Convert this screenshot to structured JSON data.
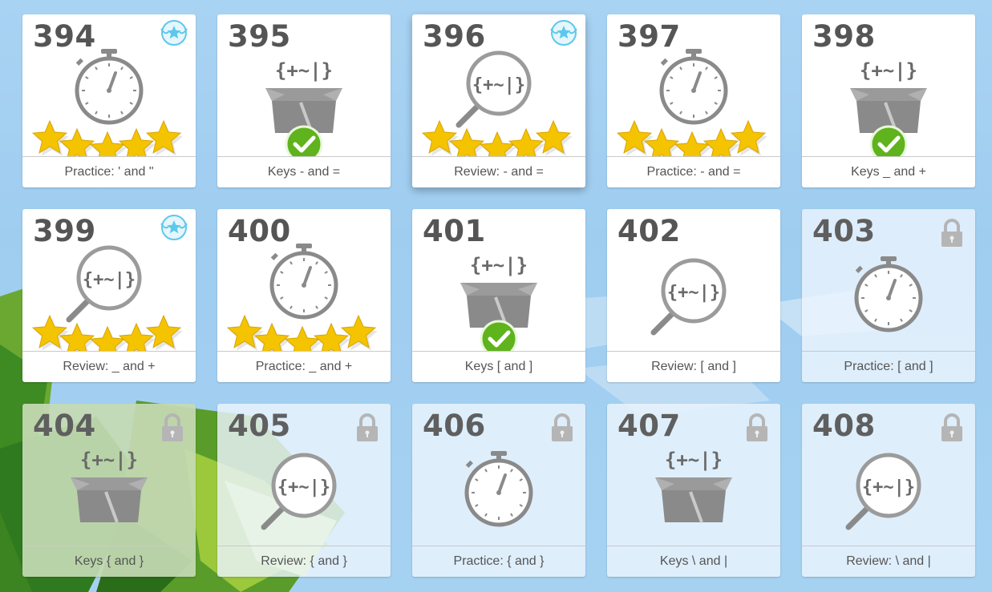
{
  "lessons": [
    {
      "number": "394",
      "label": "Practice: ' and \"",
      "kind": "timer",
      "stars": 5,
      "complete": false,
      "badge": true,
      "locked": false
    },
    {
      "number": "395",
      "label": "Keys - and =",
      "kind": "box",
      "stars": 0,
      "complete": true,
      "badge": false,
      "locked": false
    },
    {
      "number": "396",
      "label": "Review: - and =",
      "kind": "magnifier",
      "stars": 5,
      "complete": false,
      "badge": true,
      "locked": false
    },
    {
      "number": "397",
      "label": "Practice: - and =",
      "kind": "timer",
      "stars": 5,
      "complete": false,
      "badge": false,
      "locked": false
    },
    {
      "number": "398",
      "label": "Keys _ and +",
      "kind": "box",
      "stars": 0,
      "complete": true,
      "badge": false,
      "locked": false
    },
    {
      "number": "399",
      "label": "Review: _ and +",
      "kind": "magnifier",
      "stars": 5,
      "complete": false,
      "badge": true,
      "locked": false
    },
    {
      "number": "400",
      "label": "Practice: _ and +",
      "kind": "timer",
      "stars": 5,
      "complete": false,
      "badge": false,
      "locked": false
    },
    {
      "number": "401",
      "label": "Keys [ and ]",
      "kind": "box",
      "stars": 0,
      "complete": true,
      "badge": false,
      "locked": false
    },
    {
      "number": "402",
      "label": "Review: [ and ]",
      "kind": "magnifier",
      "stars": 0,
      "complete": false,
      "badge": false,
      "locked": false
    },
    {
      "number": "403",
      "label": "Practice: [ and ]",
      "kind": "timer",
      "stars": 0,
      "complete": false,
      "badge": false,
      "locked": true
    },
    {
      "number": "404",
      "label": "Keys { and }",
      "kind": "box",
      "stars": 0,
      "complete": false,
      "badge": false,
      "locked": true
    },
    {
      "number": "405",
      "label": "Review: { and }",
      "kind": "magnifier",
      "stars": 0,
      "complete": false,
      "badge": false,
      "locked": true
    },
    {
      "number": "406",
      "label": "Practice: { and }",
      "kind": "timer",
      "stars": 0,
      "complete": false,
      "badge": false,
      "locked": true
    },
    {
      "number": "407",
      "label": "Keys \\ and |",
      "kind": "box",
      "stars": 0,
      "complete": false,
      "badge": false,
      "locked": true
    },
    {
      "number": "408",
      "label": "Review: \\ and |",
      "kind": "magnifier",
      "stars": 0,
      "complete": false,
      "badge": false,
      "locked": true
    }
  ],
  "symbol_text": "{+~|}",
  "colors": {
    "star": "#f5c400",
    "check": "#5fb31c",
    "badge": "#5cc8ec",
    "icon_gray": "#8a8a8a"
  }
}
